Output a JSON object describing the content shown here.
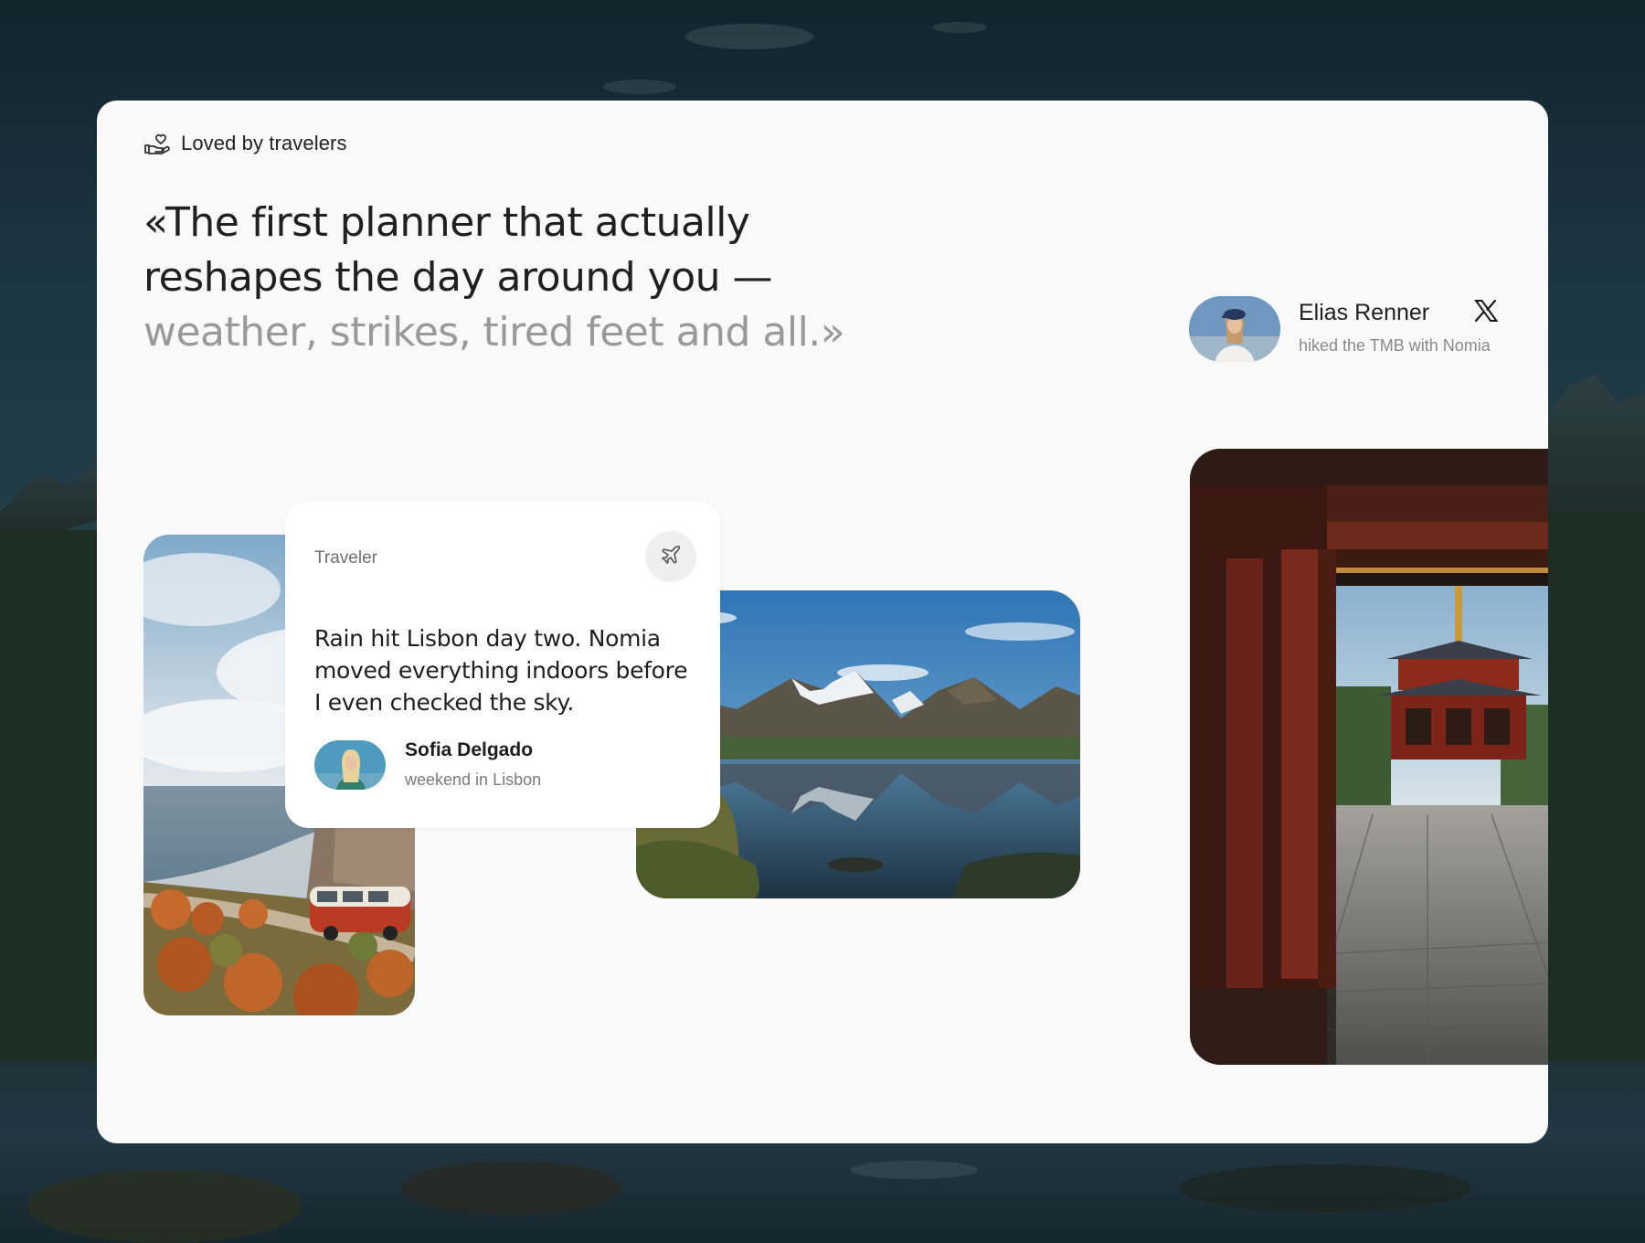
{
  "section": {
    "eyebrow_icon": "hand-heart-icon",
    "eyebrow_label": "Loved by travelers"
  },
  "quote": {
    "line1": "«The first planner that actually",
    "line2": "reshapes the day around you —",
    "line3": "weather, strikes, tired feet and all.»"
  },
  "author": {
    "name": "Elias Renner",
    "subtitle": "hiked the TMB with Nomia",
    "social_icon": "x-logo-icon"
  },
  "testimonial": {
    "label": "Traveler",
    "action_icon": "airplane-icon",
    "text": "Rain hit Lisbon day two. Nomia moved everything indoors before I even checked the sky.",
    "name": "Sofia Delgado",
    "subtitle": "weekend in Lisbon"
  },
  "colors": {
    "card_bg": "#f9f9f9",
    "text_primary": "#202020",
    "text_muted": "#999999",
    "page_bg": "#152a33"
  }
}
